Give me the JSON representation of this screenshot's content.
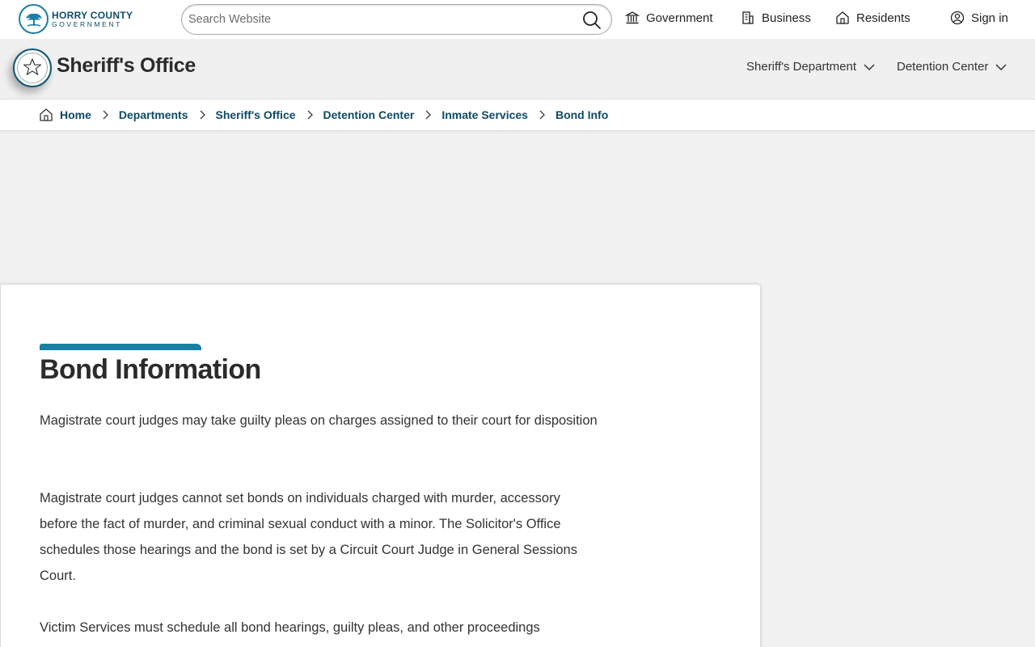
{
  "topbar": {
    "logo": {
      "line1": "HORRY COUNTY",
      "line2": "GOVERNMENT"
    },
    "search": {
      "placeholder": "Search Website",
      "value": ""
    },
    "nav": [
      {
        "label": "Government",
        "icon": "building-columns-icon"
      },
      {
        "label": "Business",
        "icon": "office-building-icon"
      },
      {
        "label": "Residents",
        "icon": "house-icon"
      }
    ],
    "sign_in": {
      "label": "Sign in",
      "icon": "user-circle-icon"
    }
  },
  "header": {
    "title": "Sheriff's Office",
    "badge_icon": "sheriff-star-icon",
    "menus": [
      {
        "label": "Sheriff's Department"
      },
      {
        "label": "Detention Center"
      }
    ]
  },
  "breadcrumb": {
    "home_icon": "home-icon",
    "items": [
      "Home",
      "Departments",
      "Sheriff's Office",
      "Detention Center",
      "Inmate Services",
      "Bond Info"
    ]
  },
  "content": {
    "title": "Bond Information",
    "paragraphs": [
      "Magistrate court judges may take guilty pleas on charges assigned to their court for disposition",
      "Magistrate court judges cannot set bonds on individuals charged with murder, accessory before the fact of murder, and criminal sexual conduct with a minor.  The Solicitor's Office schedules those hearings and the bond is set by a Circuit Court Judge in General Sessions Court.",
      "Victim Services must schedule all bond hearings, guilty pleas, and other proceedings"
    ]
  },
  "colors": {
    "accent": "#1a7fa3",
    "link": "#0d4a66",
    "page_background": "#f1f1f1"
  }
}
